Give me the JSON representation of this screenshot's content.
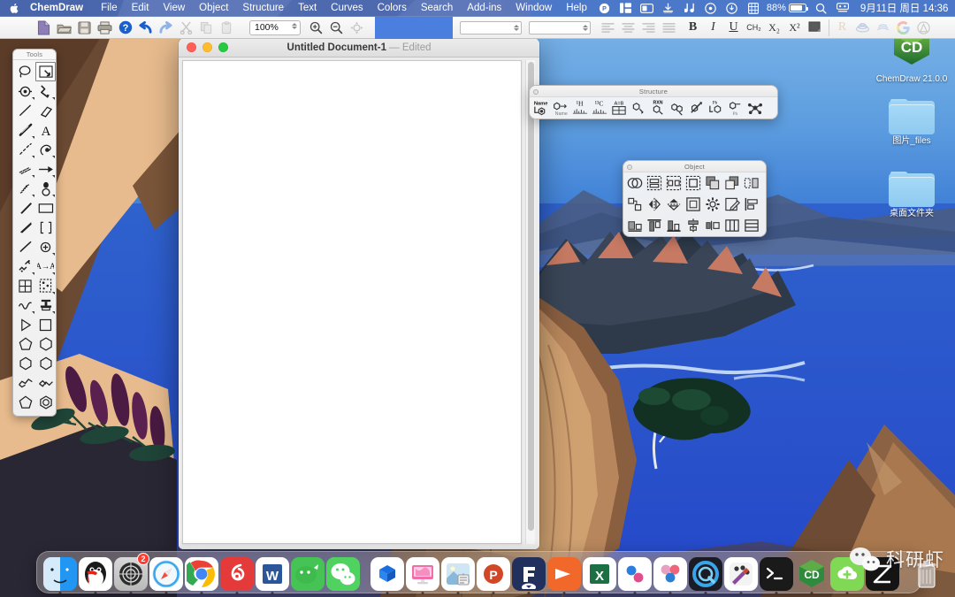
{
  "menubar": {
    "apple_icon": "apple-icon",
    "app_name": "ChemDraw",
    "items": [
      "File",
      "Edit",
      "View",
      "Object",
      "Structure",
      "Text",
      "Curves",
      "Colors",
      "Search",
      "Add-ins",
      "Window",
      "Help"
    ],
    "status_icons": [
      "p-circle-icon",
      "columns-icon",
      "screen-icon",
      "download-icon",
      "music-app-icon",
      "play-circle-icon",
      "arrow-down-circle-icon",
      "grid-icon"
    ],
    "battery_percent": "88%",
    "search_icon": "search-icon",
    "controlcenter_icon": "control-center-icon",
    "clock": "9月11日 周日  14:36"
  },
  "toolbar": {
    "buttons": [
      {
        "name": "new-document-button",
        "icon": "document-icon"
      },
      {
        "name": "open-document-button",
        "icon": "open-folder-icon"
      },
      {
        "name": "save-document-button",
        "icon": "floppy-disk-icon"
      },
      {
        "name": "print-button",
        "icon": "printer-icon"
      },
      {
        "name": "help-button",
        "icon": "question-circle-icon"
      },
      {
        "name": "undo-button",
        "icon": "undo-arrow-icon"
      },
      {
        "name": "redo-button",
        "icon": "redo-arrow-icon"
      },
      {
        "name": "cut-button",
        "icon": "scissors-icon"
      },
      {
        "name": "copy-button",
        "icon": "copy-icon"
      },
      {
        "name": "paste-button",
        "icon": "paste-icon"
      }
    ],
    "zoom_value": "100%",
    "zoom_in": "zoom-in-icon",
    "zoom_out": "zoom-out-icon",
    "zoom_fit": "zoom-fit-icon",
    "align_buttons": [
      "align-left-icon",
      "align-center-icon",
      "align-right-icon",
      "align-justify-icon"
    ],
    "bold_label": "B",
    "italic_label": "I",
    "underline_label": "U",
    "format_labels": [
      "CH₂",
      "X₂",
      "X²"
    ],
    "color_swatch": "#5a5a5a",
    "right_group": [
      "r-label-icon",
      "chemscript-icon",
      "chemdraw-cloud-icon",
      "google-search-icon",
      "warning-icon"
    ],
    "r_label": "R"
  },
  "tools_palette": {
    "title": "Tools",
    "selected_index": 1,
    "tools": [
      {
        "name": "lasso-select-tool",
        "icon": "lasso-icon"
      },
      {
        "name": "marquee-select-tool",
        "icon": "marquee-arrow-icon"
      },
      {
        "name": "eraser-target-tool",
        "icon": "target-circle-icon"
      },
      {
        "name": "chain-tool",
        "icon": "zigzag-chain-icon"
      },
      {
        "name": "solid-bond-tool",
        "icon": "plain-line-icon"
      },
      {
        "name": "eraser-tool",
        "icon": "eraser-icon"
      },
      {
        "name": "bold-bond-tool",
        "icon": "bold-bond-icon"
      },
      {
        "name": "text-tool",
        "icon": "letter-a-icon"
      },
      {
        "name": "dashed-bond-tool",
        "icon": "dashed-bond-icon"
      },
      {
        "name": "pen-tool",
        "icon": "pen-hand-icon"
      },
      {
        "name": "hashed-bond-tool",
        "icon": "hashed-bond-icon"
      },
      {
        "name": "arrow-tool",
        "icon": "arrow-icon"
      },
      {
        "name": "hashed-wedge-tool",
        "icon": "hashed-wedge-icon"
      },
      {
        "name": "orbital-tool",
        "icon": "orbital-icon"
      },
      {
        "name": "bold-wedge-tool",
        "icon": "wedge-icon"
      },
      {
        "name": "rectangle-tool",
        "icon": "rectangle-icon"
      },
      {
        "name": "wedged-bond-tool",
        "icon": "wedged-bond-icon"
      },
      {
        "name": "bracket-tool",
        "icon": "brackets-icon"
      },
      {
        "name": "hollow-wedge-tool",
        "icon": "hollow-wedge-icon"
      },
      {
        "name": "atom-charge-tool",
        "icon": "circle-plus-icon"
      },
      {
        "name": "bond-chain-tool",
        "icon": "multi-bond-icon"
      },
      {
        "name": "atom-map-tool",
        "icon": "a-to-a-icon"
      },
      {
        "name": "table-tool",
        "icon": "table-grid-icon"
      },
      {
        "name": "tlc-plate-tool",
        "icon": "tlc-plate-icon"
      },
      {
        "name": "curve-tool",
        "icon": "squiggle-curve-icon"
      },
      {
        "name": "lab-equipment-tool",
        "icon": "flask-stamp-icon"
      },
      {
        "name": "triangle-tool",
        "icon": "triangle-icon"
      },
      {
        "name": "square-tool",
        "icon": "square-icon"
      },
      {
        "name": "pentagon-tool",
        "icon": "pentagon-icon"
      },
      {
        "name": "hexagon-tool",
        "icon": "hexagon-icon"
      },
      {
        "name": "cyclohexane-tool",
        "icon": "cyclohexane-icon"
      },
      {
        "name": "cyclopentane-tool",
        "icon": "cyclopentane-icon"
      },
      {
        "name": "chair-ring-tool",
        "icon": "chair-ring-icon"
      },
      {
        "name": "chair-ring-alt-tool",
        "icon": "chair-ring-alt-icon"
      },
      {
        "name": "cyclopentadiene-tool",
        "icon": "cyclopentadiene-icon"
      },
      {
        "name": "benzene-tool",
        "icon": "benzene-ring-icon"
      }
    ]
  },
  "document_window": {
    "title": "Untitled Document-1",
    "separator": "—",
    "edited_label": "Edited",
    "traffic_lights": [
      "close-button",
      "minimize-button",
      "zoom-button"
    ]
  },
  "structure_palette": {
    "title": "Structure",
    "buttons": [
      {
        "name": "name-to-structure-button",
        "icon": "name-structure-icon",
        "label": "Name"
      },
      {
        "name": "structure-to-name-button",
        "icon": "structure-name-icon",
        "label": "Name"
      },
      {
        "name": "predict-h-nmr-button",
        "icon": "h-nmr-icon",
        "label": "1H"
      },
      {
        "name": "predict-c-nmr-button",
        "icon": "c-nmr-icon",
        "label": "13C"
      },
      {
        "name": "structure-properties-button",
        "icon": "properties-table-icon",
        "label": "A=B"
      },
      {
        "name": "check-structure-button",
        "icon": "check-structure-icon"
      },
      {
        "name": "clean-reaction-button",
        "icon": "rxn-icon",
        "label": "RXN"
      },
      {
        "name": "map-atoms-button",
        "icon": "map-atoms-icon"
      },
      {
        "name": "clean-structure-button",
        "icon": "clean-structure-icon"
      },
      {
        "name": "add-ligand-button",
        "icon": "ph-ligand-icon",
        "label": "Ph"
      },
      {
        "name": "expand-label-button",
        "icon": "expand-label-icon",
        "label": "Ph"
      },
      {
        "name": "three-d-model-button",
        "icon": "three-d-model-icon"
      }
    ]
  },
  "object_palette": {
    "title": "Object",
    "rows": [
      [
        {
          "name": "group-objects-button",
          "icon": "overlapping-circles-icon"
        },
        {
          "name": "align-objects-button",
          "icon": "align-objects-icon"
        },
        {
          "name": "distribute-objects-button",
          "icon": "distribute-objects-icon"
        },
        {
          "name": "fit-to-object-button",
          "icon": "fit-object-icon"
        },
        {
          "name": "bring-to-front-button",
          "icon": "bring-front-icon"
        },
        {
          "name": "send-to-back-button",
          "icon": "send-back-icon"
        },
        {
          "name": "ungroup-button",
          "icon": "ungroup-icon"
        }
      ],
      [
        {
          "name": "join-objects-button",
          "icon": "join-icon"
        },
        {
          "name": "flip-horizontal-button",
          "icon": "flip-horizontal-icon"
        },
        {
          "name": "flip-vertical-button",
          "icon": "flip-vertical-icon"
        },
        {
          "name": "object-frame-button",
          "icon": "frame-icon"
        },
        {
          "name": "object-settings-button",
          "icon": "gear-icon"
        },
        {
          "name": "edit-object-button",
          "icon": "edit-pencil-icon"
        },
        {
          "name": "align-left-edges-button",
          "icon": "align-left-edges-icon"
        }
      ],
      [
        {
          "name": "align-bottom-button",
          "icon": "align-bottom-icon"
        },
        {
          "name": "align-top-button",
          "icon": "align-top-icon"
        },
        {
          "name": "align-baseline-button",
          "icon": "align-baseline-icon"
        },
        {
          "name": "center-horizontally-button",
          "icon": "center-horizontal-icon"
        },
        {
          "name": "distribute-horizontal-button",
          "icon": "distribute-horizontal-icon"
        },
        {
          "name": "distribute-columns-button",
          "icon": "columns-distribute-icon"
        },
        {
          "name": "distribute-rows-button",
          "icon": "rows-distribute-icon"
        }
      ]
    ]
  },
  "desktop_icons": [
    {
      "name": "desktop-icon-chemdraw",
      "label": "ChemDraw 21.0.0",
      "icon": "chemdraw-app-icon"
    },
    {
      "name": "desktop-icon-images-folder",
      "label": "图片_files",
      "icon": "folder-icon"
    },
    {
      "name": "desktop-icon-desktop-folder",
      "label": "桌面文件夹",
      "icon": "folder-icon"
    }
  ],
  "dock": {
    "items": [
      {
        "name": "dock-finder",
        "icon": "finder-icon",
        "running": true
      },
      {
        "name": "dock-qq",
        "icon": "qq-penguin-icon",
        "running": true
      },
      {
        "name": "dock-app-badge",
        "icon": "compass-dark-icon",
        "badge": "2",
        "running": true
      },
      {
        "name": "dock-safari",
        "icon": "safari-icon",
        "running": true
      },
      {
        "name": "dock-chrome",
        "icon": "chrome-icon",
        "running": true
      },
      {
        "name": "dock-netease-music",
        "icon": "netease-music-icon",
        "running": true
      },
      {
        "name": "dock-word",
        "icon": "microsoft-word-icon",
        "running": true
      },
      {
        "name": "dock-wechat-work",
        "icon": "wechat-work-icon",
        "running": false
      },
      {
        "name": "dock-wechat",
        "icon": "wechat-icon",
        "running": false
      },
      {
        "name": "dock-onedrive",
        "icon": "blue-box-icon",
        "running": true
      },
      {
        "name": "dock-imac",
        "icon": "imac-icon",
        "running": true
      },
      {
        "name": "dock-photos-preview",
        "icon": "preview-photo-icon",
        "running": true
      },
      {
        "name": "dock-powerpoint",
        "icon": "microsoft-powerpoint-icon",
        "running": true
      },
      {
        "name": "dock-figma-like",
        "icon": "f-dark-blue-icon",
        "running": true
      },
      {
        "name": "dock-keynote",
        "icon": "orange-play-icon",
        "running": true
      },
      {
        "name": "dock-excel",
        "icon": "microsoft-excel-icon",
        "running": true
      },
      {
        "name": "dock-sketch",
        "icon": "blue-s-icon",
        "running": true
      },
      {
        "name": "dock-baidu-netdisk",
        "icon": "three-circles-icon",
        "running": true
      },
      {
        "name": "dock-quicktime",
        "icon": "quicktime-icon",
        "running": true
      },
      {
        "name": "dock-paint-app",
        "icon": "paint-palette-icon",
        "running": true
      },
      {
        "name": "dock-terminal",
        "icon": "terminal-icon",
        "running": true
      },
      {
        "name": "dock-chemdraw",
        "icon": "chemdraw-app-icon",
        "running": true
      },
      {
        "name": "dock-cloud-plus",
        "icon": "cloud-plus-icon",
        "running": true
      },
      {
        "name": "dock-compress-app",
        "icon": "black-compress-icon",
        "running": true
      },
      {
        "name": "dock-trash",
        "icon": "trash-icon",
        "running": false
      }
    ]
  },
  "watermark": {
    "logo": "wechat-logo-icon",
    "text": "科研虾"
  }
}
